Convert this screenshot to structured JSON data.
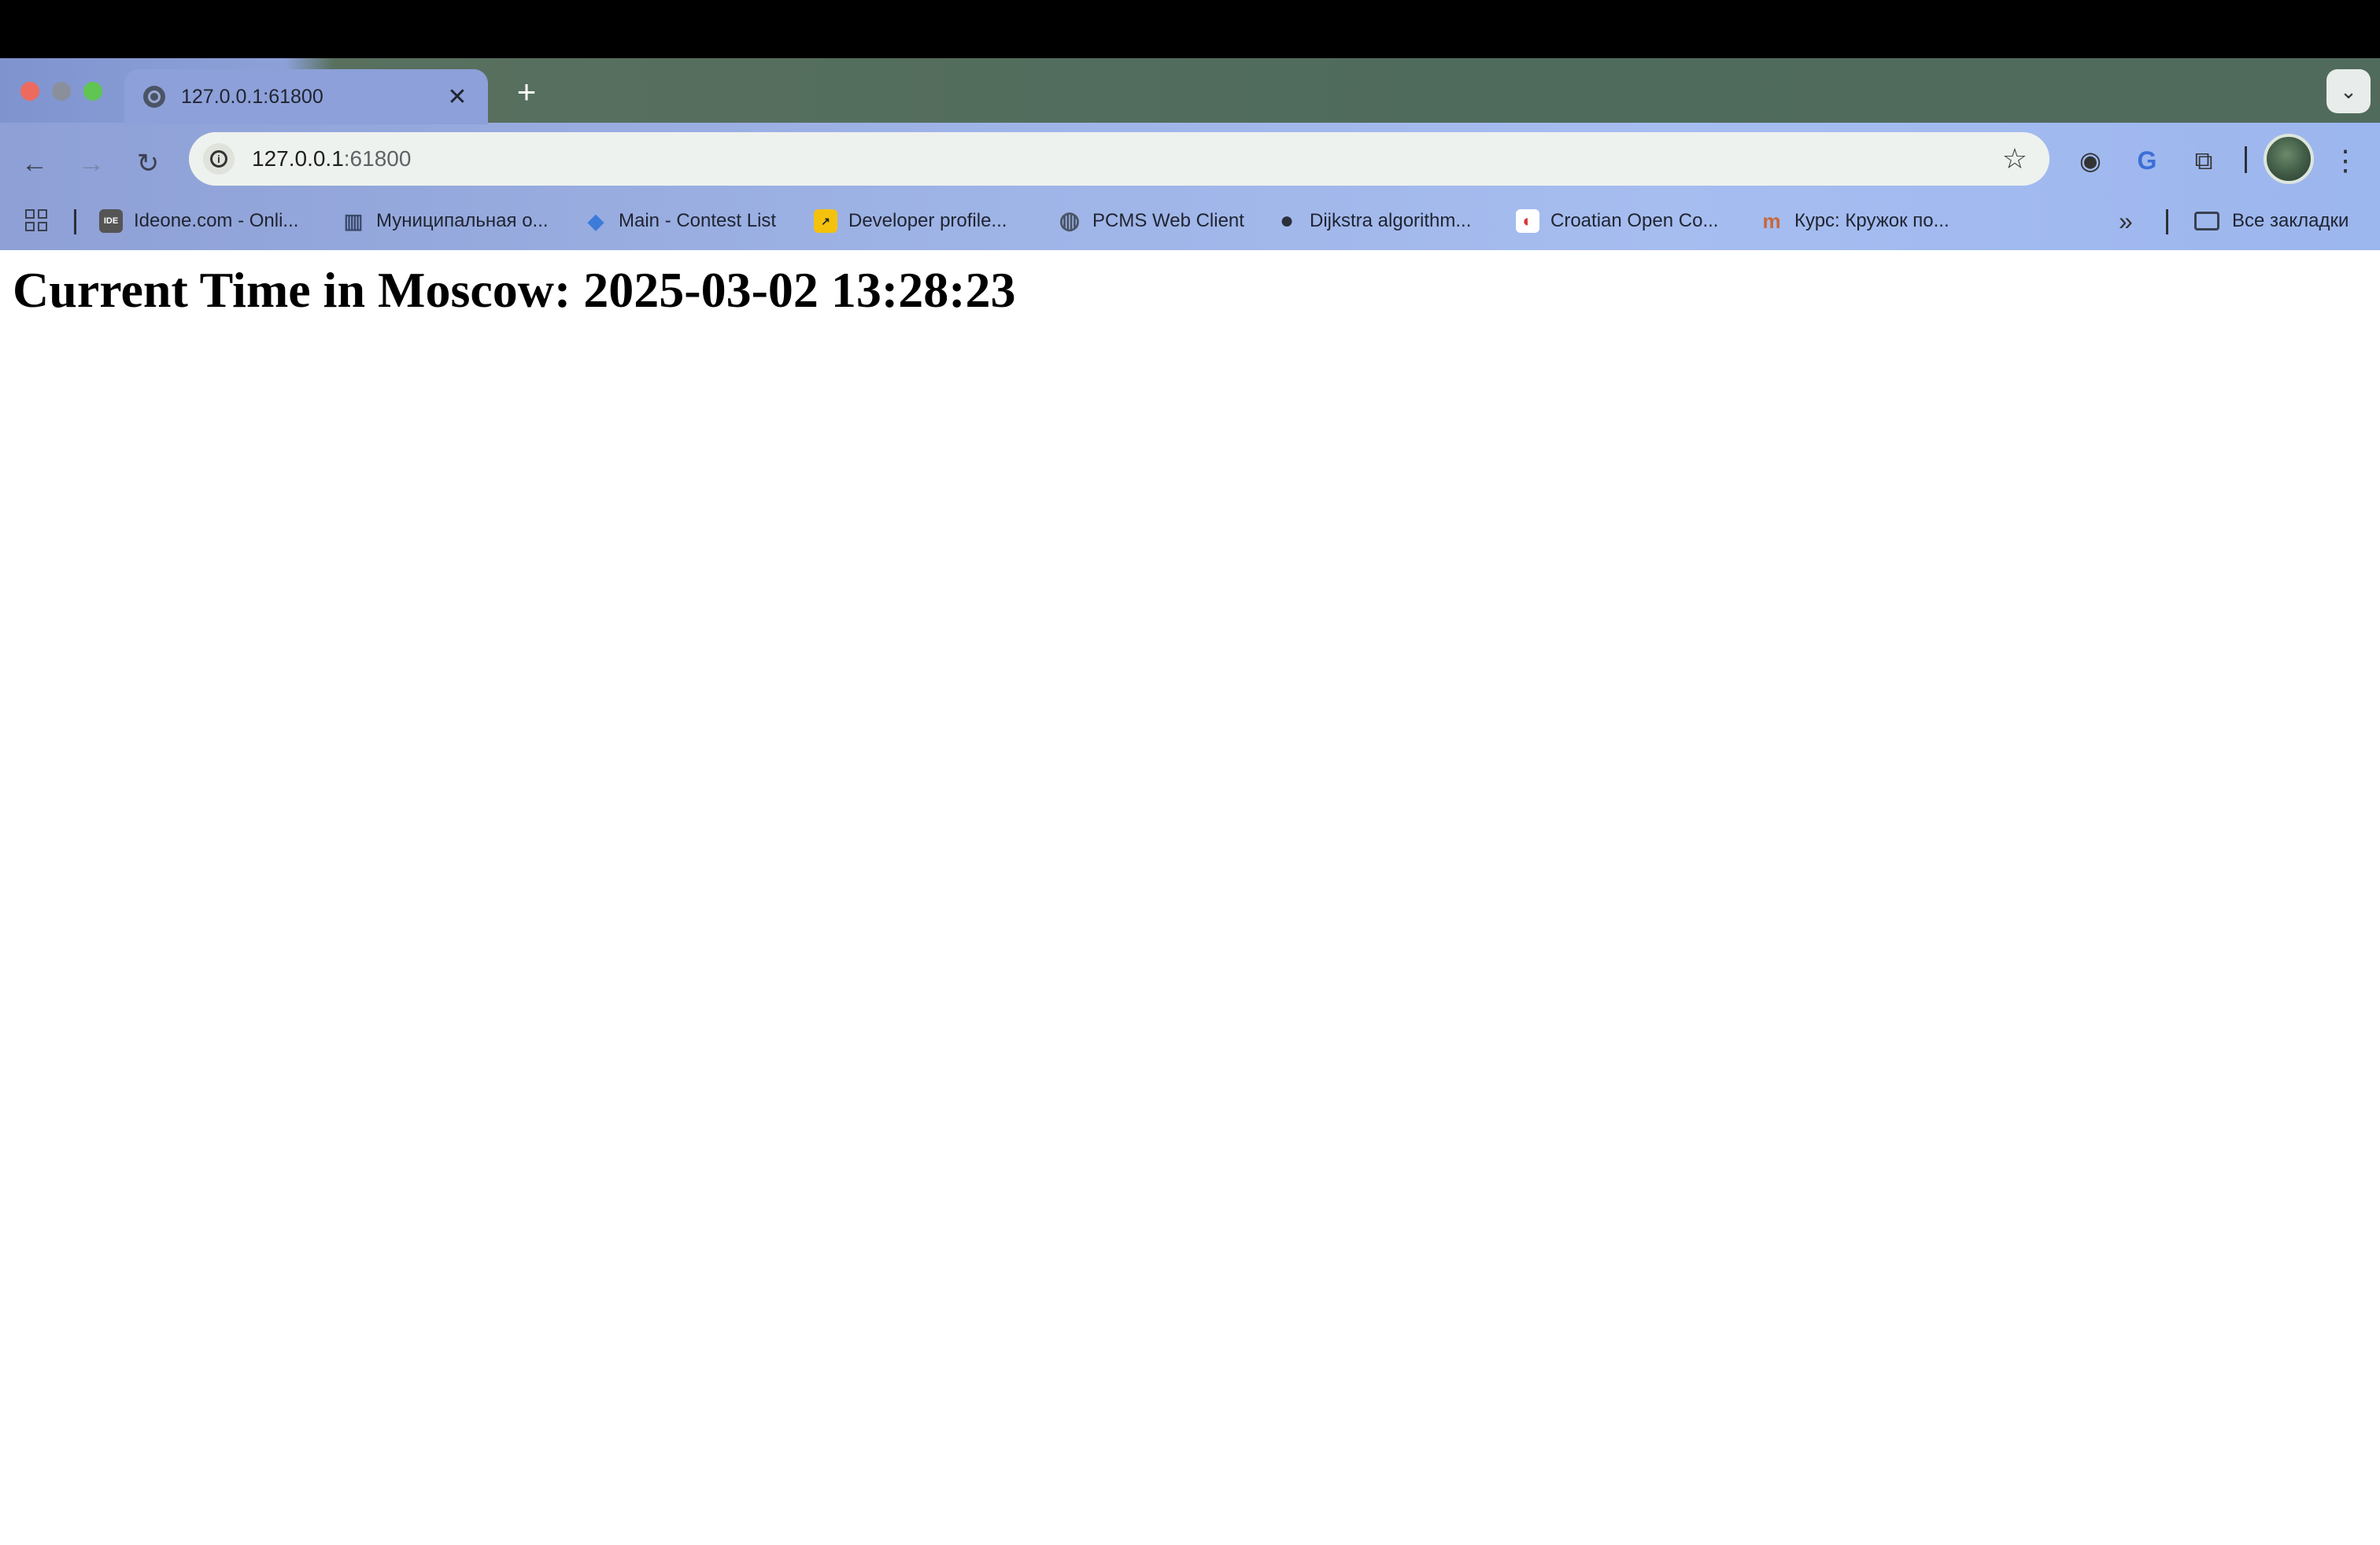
{
  "tab": {
    "title": "127.0.0.1:61800",
    "close": "✕"
  },
  "new_tab": "+",
  "tab_search": "⌄",
  "nav": {
    "back": "←",
    "forward": "→",
    "reload": "↻"
  },
  "omnibox": {
    "host": "127.0.0.1",
    "port": ":61800",
    "star": "☆"
  },
  "toolbar": {
    "extension_1": "◉",
    "translate": "G",
    "extensions": "⧉",
    "menu": "⋮"
  },
  "bookmarks": {
    "items": [
      {
        "label": "Ideone.com - Onli...",
        "icon": "ideone-icon",
        "color": "#555555",
        "glyph": "IDE"
      },
      {
        "label": "Муниципальная о...",
        "icon": "building-icon",
        "color": "#3b4a6b",
        "glyph": "▥"
      },
      {
        "label": "Main - Contest List",
        "icon": "contest-icon",
        "color": "#3d7bd9",
        "glyph": "◆"
      },
      {
        "label": "Developer profile...",
        "icon": "developer-icon",
        "color": "#f4c20d",
        "glyph": "↗"
      },
      {
        "label": "PCMS Web Client",
        "icon": "globe-icon",
        "color": "#4a5466",
        "glyph": "◍"
      },
      {
        "label": "Dijkstra algorithm...",
        "icon": "github-icon",
        "color": "#2b2f3a",
        "glyph": "●"
      },
      {
        "label": "Croatian Open Co...",
        "icon": "croatian-open-icon",
        "color": "#ffffff",
        "glyph": "◐"
      },
      {
        "label": "Курс: Кружок по...",
        "icon": "course-icon",
        "color": "#c9683a",
        "glyph": "m"
      }
    ],
    "more": "»",
    "all_bookmarks": "Все закладки"
  },
  "page": {
    "heading": "Current Time in Moscow: 2025-03-02 13:28:23"
  }
}
